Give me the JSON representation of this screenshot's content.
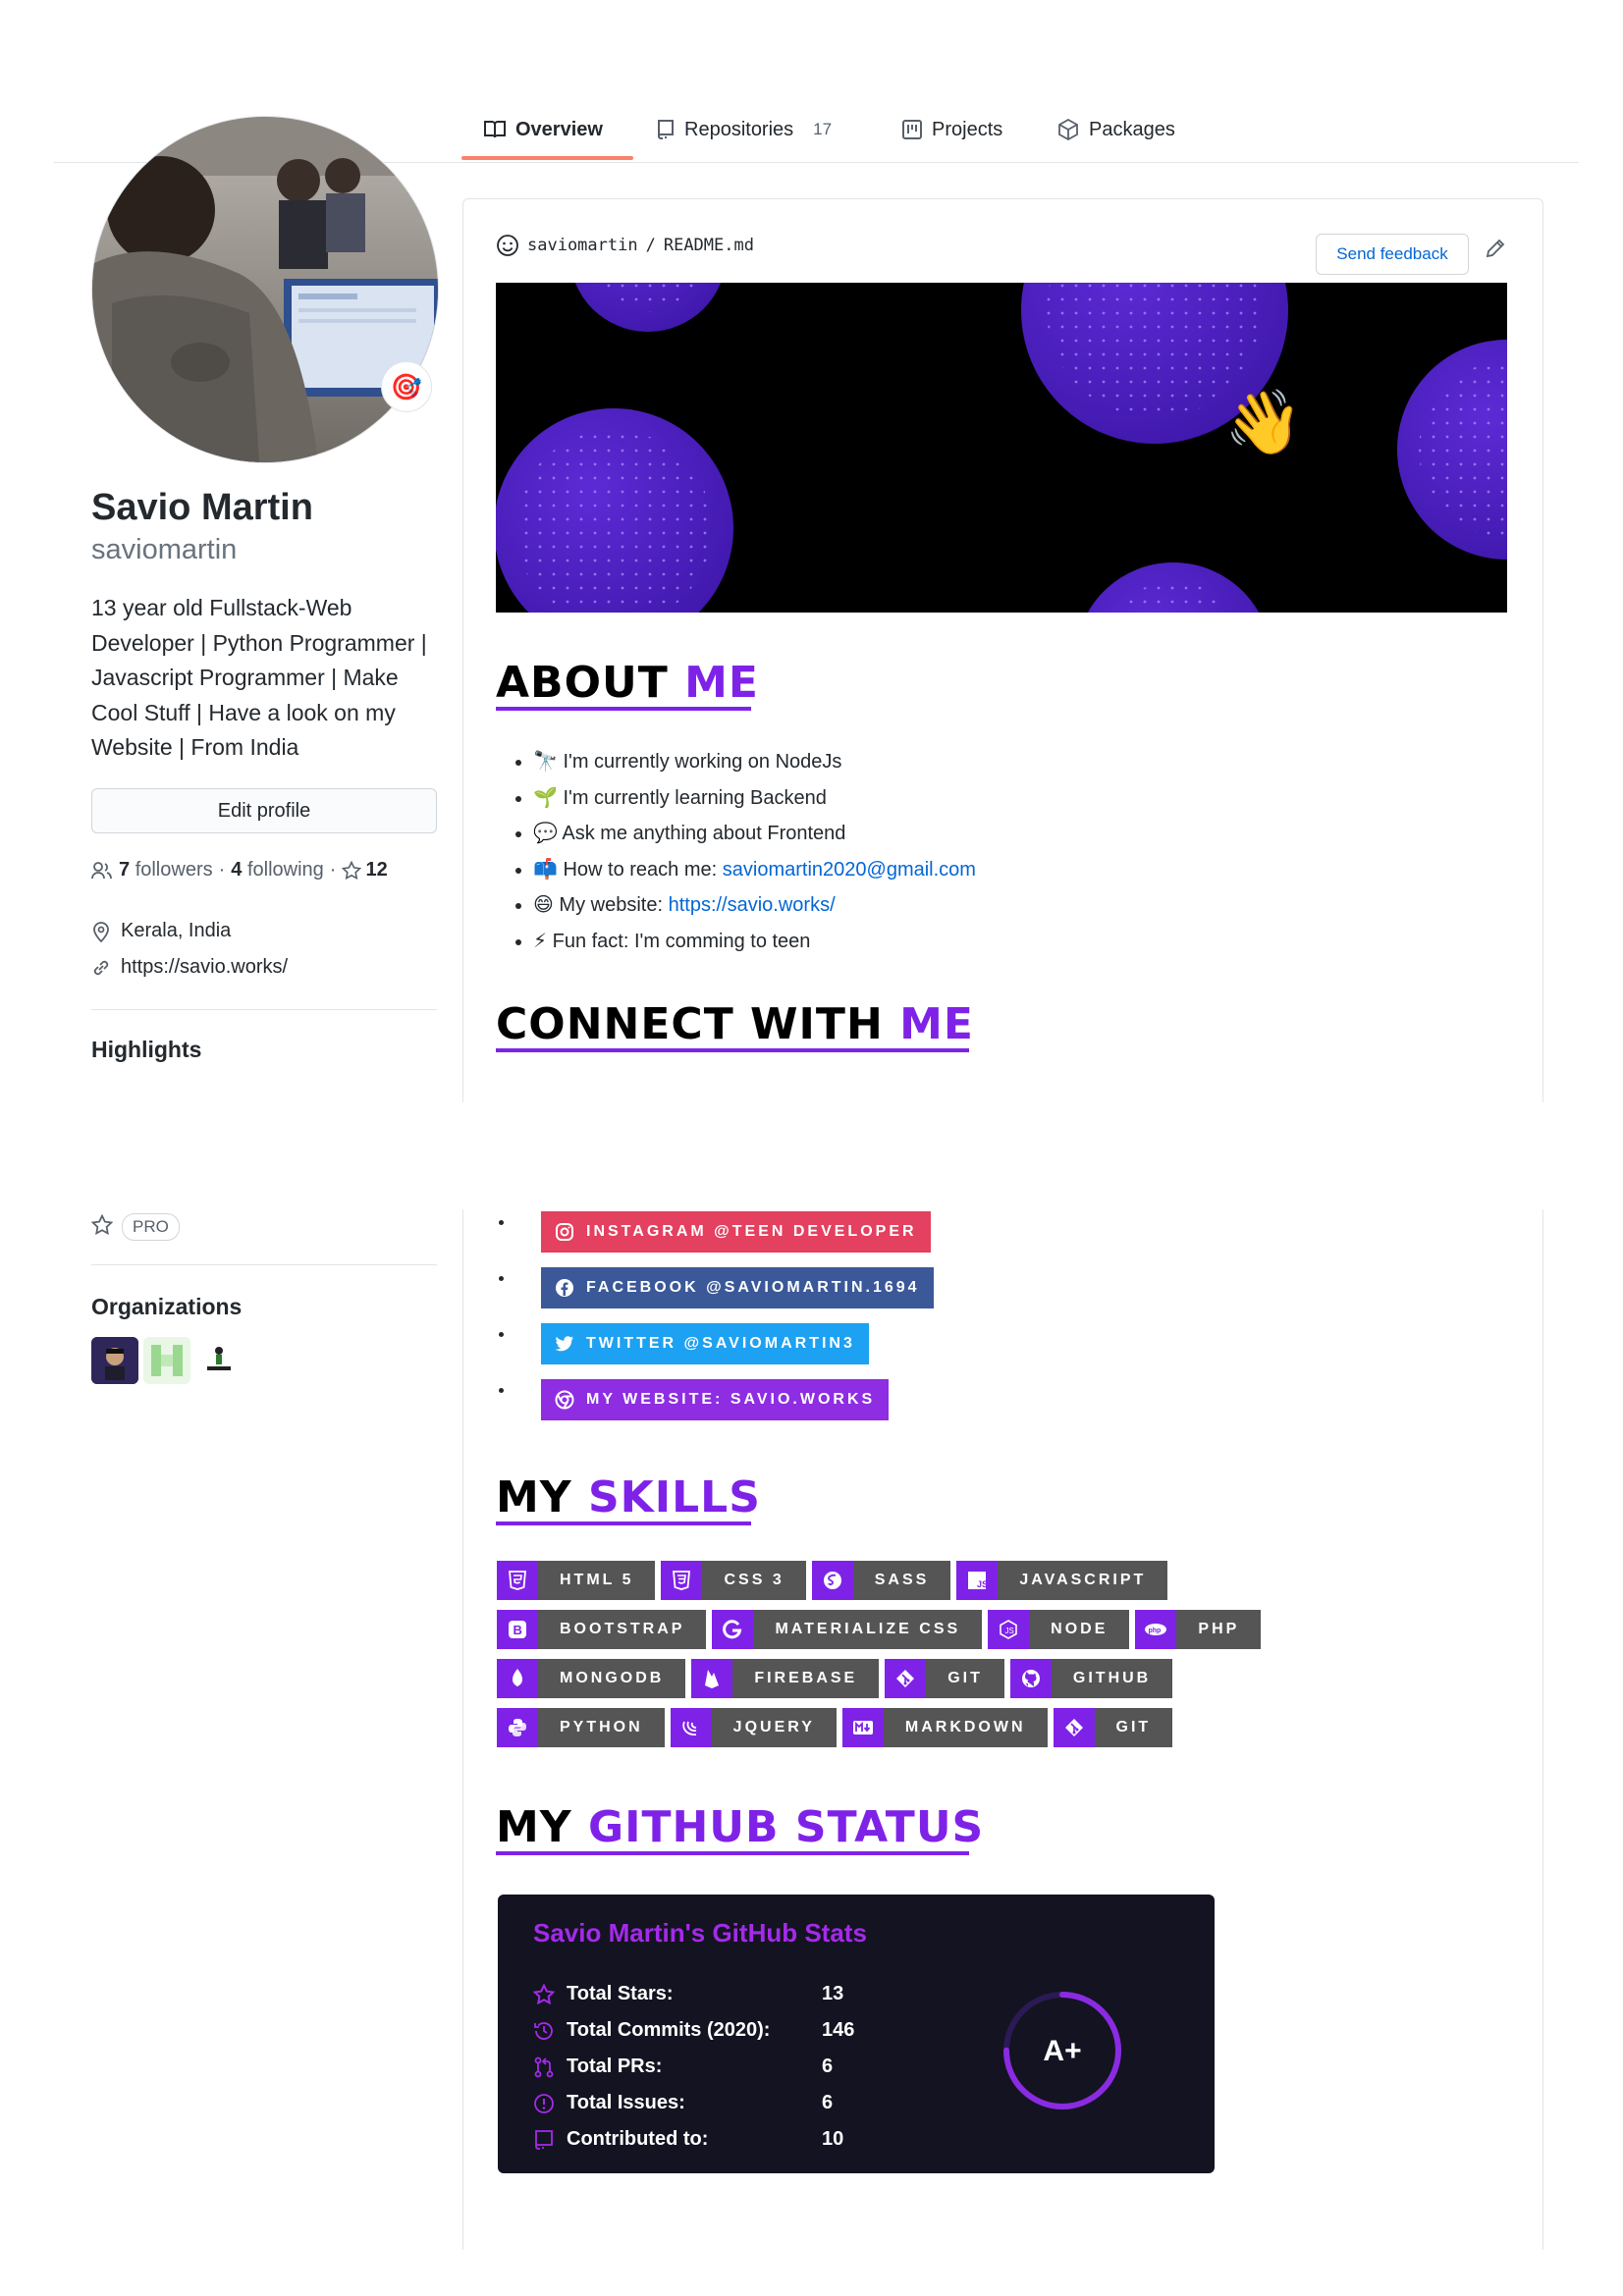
{
  "tabs": [
    {
      "label": "Overview",
      "icon": "book-icon",
      "active": true
    },
    {
      "label": "Repositories",
      "icon": "repo-icon",
      "count": "17"
    },
    {
      "label": "Projects",
      "icon": "project-icon"
    },
    {
      "label": "Packages",
      "icon": "package-icon"
    }
  ],
  "profile": {
    "name": "Savio Martin",
    "login": "saviomartin",
    "bio": "13 year old Fullstack-Web Developer | Python Programmer | Javascript Programmer | Make Cool Stuff | Have a look on my Website | From India",
    "edit_label": "Edit profile",
    "followers_count": "7",
    "followers_label": "followers",
    "following_count": "4",
    "following_label": "following",
    "stars": "12",
    "separator": "·",
    "location": "Kerala, India",
    "website": "https://savio.works/",
    "status_emoji": "🎯"
  },
  "highlights": {
    "title": "Highlights",
    "pro_label": "PRO"
  },
  "organizations": {
    "title": "Organizations"
  },
  "readme": {
    "owner": "saviomartin",
    "slash": "/",
    "file": "README.md",
    "feedback_label": "Send feedback",
    "wave_emoji": "👋"
  },
  "about": {
    "heading_main": "ABOUT ",
    "heading_accent": "ME",
    "items": [
      {
        "emoji": "🔭",
        "text": "I'm currently working on NodeJs",
        "link": ""
      },
      {
        "emoji": "🌱",
        "text": "I'm currently learning Backend",
        "link": ""
      },
      {
        "emoji": "💬",
        "text": "Ask me anything about Frontend",
        "link": ""
      },
      {
        "emoji": "📫",
        "text": "How to reach me: ",
        "link": "saviomartin2020@gmail.com"
      },
      {
        "emoji": "😄",
        "text": "My website: ",
        "link": "https://savio.works/"
      },
      {
        "emoji": "⚡",
        "text": "Fun fact: I'm comming to teen",
        "link": ""
      }
    ]
  },
  "connect": {
    "heading_main": "CONNECT WITH ",
    "heading_accent": "ME",
    "badges": [
      {
        "label": "INSTAGRAM @TEEN DEVELOPER",
        "color": "#e4405f",
        "icon": "instagram-icon"
      },
      {
        "label": "FACEBOOK @SAVIOMARTIN.1694",
        "color": "#3b5998",
        "icon": "facebook-icon"
      },
      {
        "label": "TWITTER @SAVIOMARTIN3",
        "color": "#1da1f2",
        "icon": "twitter-icon"
      },
      {
        "label": "MY WEBSITE: SAVIO.WORKS",
        "color": "#8e2de2",
        "icon": "chrome-icon"
      }
    ]
  },
  "skills": {
    "heading_main": "MY ",
    "heading_accent": "SKILLS",
    "rows": [
      [
        {
          "label": "HTML 5",
          "glyph": "5"
        },
        {
          "label": "CSS 3",
          "glyph": "3"
        },
        {
          "label": "SASS",
          "glyph": "S"
        },
        {
          "label": "JAVASCRIPT",
          "glyph": "JS"
        }
      ],
      [
        {
          "label": "BOOTSTRAP",
          "glyph": "B"
        },
        {
          "label": "MATERIALIZE CSS",
          "glyph": "G"
        },
        {
          "label": "NODE",
          "glyph": "⬡"
        },
        {
          "label": "PHP",
          "glyph": "php"
        }
      ],
      [
        {
          "label": "MONGODB",
          "glyph": "♦"
        },
        {
          "label": "FIREBASE",
          "glyph": "▲"
        },
        {
          "label": "GIT",
          "glyph": "◆"
        },
        {
          "label": "GITHUB",
          "glyph": "●"
        }
      ],
      [
        {
          "label": "PYTHON",
          "glyph": "❖"
        },
        {
          "label": "JQUERY",
          "glyph": "~"
        },
        {
          "label": "MARKDOWN",
          "glyph": "M↓"
        },
        {
          "label": "GIT",
          "glyph": "◆"
        }
      ]
    ]
  },
  "github_status": {
    "heading_main": "MY ",
    "heading_accent": "GITHUB STATUS",
    "card_title": "Savio Martin's GitHub Stats",
    "stats": [
      {
        "label": "Total Stars:",
        "value": "13",
        "icon": "star-icon"
      },
      {
        "label": "Total Commits (2020):",
        "value": "146",
        "icon": "history-icon"
      },
      {
        "label": "Total PRs:",
        "value": "6",
        "icon": "pull-request-icon"
      },
      {
        "label": "Total Issues:",
        "value": "6",
        "icon": "issue-icon"
      },
      {
        "label": "Contributed to:",
        "value": "10",
        "icon": "repo-icon"
      }
    ],
    "grade": "A+",
    "grade_progress": 0.75
  },
  "colors": {
    "accent": "#7f22e8",
    "tab_underline": "#f9826c",
    "link": "#0366d6",
    "card_bg": "#141321",
    "card_title": "#a42aeb"
  }
}
